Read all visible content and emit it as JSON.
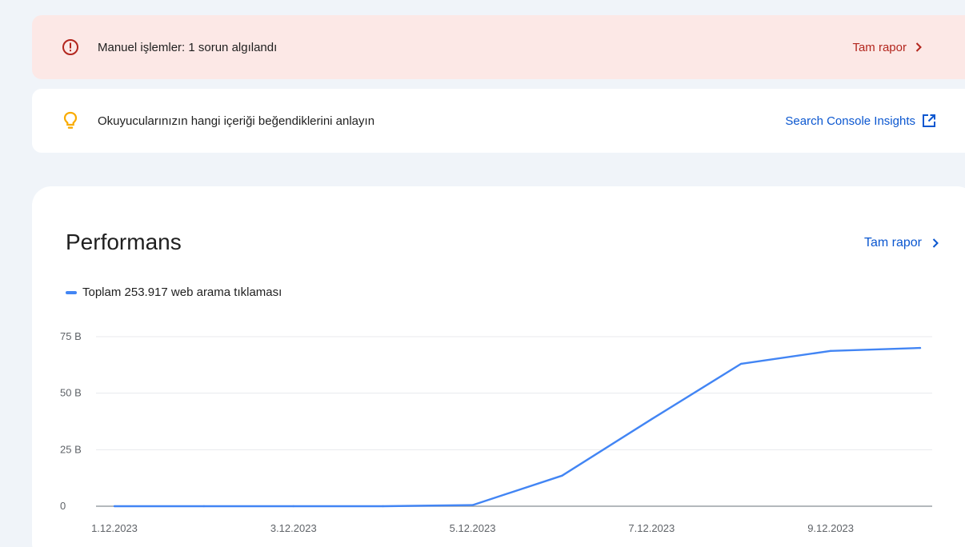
{
  "alert_banner": {
    "text": "Manuel işlemler: 1 sorun algılandı",
    "link_label": "Tam rapor",
    "icon": "error-icon",
    "color": "#b3261e",
    "background": "#fce8e6"
  },
  "tip_banner": {
    "text": "Okuyucularınızın hangi içeriği beğendiklerini anlayın",
    "link_label": "Search Console Insights",
    "icon": "lightbulb-icon",
    "link_icon": "open-in-new-icon",
    "icon_color": "#f9ab00",
    "link_color": "#0b57d0"
  },
  "performance": {
    "title": "Performans",
    "link_label": "Tam rapor",
    "legend_label": "Toplam 253.917 web arama tıklaması",
    "series_color": "#4285f4"
  },
  "chart_data": {
    "type": "line",
    "x": [
      "1.12.2023",
      "2.12.2023",
      "3.12.2023",
      "4.12.2023",
      "5.12.2023",
      "6.12.2023",
      "7.12.2023",
      "8.12.2023",
      "9.12.2023",
      "10.12.2023"
    ],
    "x_tick_labels": [
      "1.12.2023",
      "3.12.2023",
      "5.12.2023",
      "7.12.2023",
      "9.12.2023"
    ],
    "series": [
      {
        "name": "Toplam 253.917 web arama tıklaması",
        "values": [
          0,
          0,
          0,
          0,
          500,
          13500,
          38500,
          63000,
          68700,
          70000
        ]
      }
    ],
    "y_ticks": [
      0,
      25000,
      50000,
      75000
    ],
    "y_tick_labels": [
      "0",
      "25 B",
      "50 B",
      "75 B"
    ],
    "ylim": [
      0,
      75000
    ],
    "grid": true,
    "title": "",
    "xlabel": "",
    "ylabel": ""
  }
}
